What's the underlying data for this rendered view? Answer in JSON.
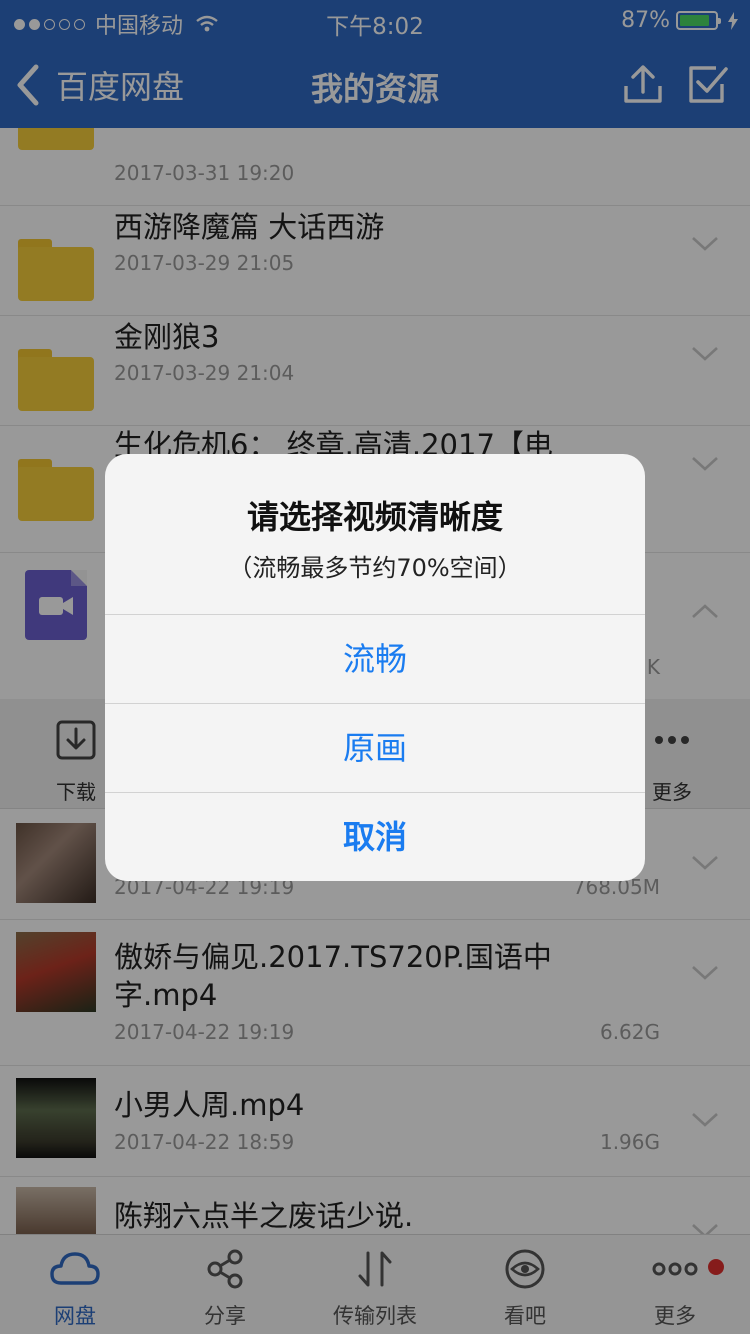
{
  "status_bar": {
    "carrier": "中国移动",
    "time": "下午8:02",
    "battery": "87%",
    "battery_level": 0.87
  },
  "nav": {
    "back_label": "百度网盘",
    "title": "我的资源",
    "upload_icon": "upload-icon",
    "select_icon": "checkbox-icon"
  },
  "folders": [
    {
      "name": "",
      "date": "2017-03-31 19:20"
    },
    {
      "name": "西游降魔篇 大话西游",
      "date": "2017-03-29 21:05"
    },
    {
      "name": "金刚狼3",
      "date": "2017-03-29 21:04"
    },
    {
      "name": "生化危机6： 终章.高清.2017【电",
      "date": ""
    }
  ],
  "expanded_file": {
    "size_fragment": "K"
  },
  "actions": {
    "download_label": "下载",
    "more_label": "更多"
  },
  "files": [
    {
      "name": "",
      "date": "2017-04-22 19:19",
      "size": "768.05M"
    },
    {
      "name": "傲娇与偏见.2017.TS720P.国语中",
      "name_line2": "字.mp4",
      "date": "2017-04-22 19:19",
      "size": "6.62G"
    },
    {
      "name": "小男人周.mp4",
      "date": "2017-04-22 18:59",
      "size": "1.96G"
    },
    {
      "name": "陈翔六点半之废话少说.",
      "date": "",
      "size": ""
    }
  ],
  "tabbar": [
    {
      "label": "网盘",
      "icon": "cloud-icon",
      "active": true
    },
    {
      "label": "分享",
      "icon": "share-icon",
      "active": false
    },
    {
      "label": "传输列表",
      "icon": "transfer-icon",
      "active": false
    },
    {
      "label": "看吧",
      "icon": "eye-icon",
      "active": false
    },
    {
      "label": "更多",
      "icon": "more-icon",
      "active": false
    }
  ],
  "alert": {
    "title": "请选择视频清晰度",
    "message": "（流畅最多节约70%空间）",
    "options": [
      "流畅",
      "原画",
      "取消"
    ]
  },
  "colors": {
    "brand_blue": "#2f69c3",
    "folder_yellow": "#f6cd3b",
    "alert_button_blue": "#1a7cf0",
    "notification_red": "#e0302e"
  }
}
